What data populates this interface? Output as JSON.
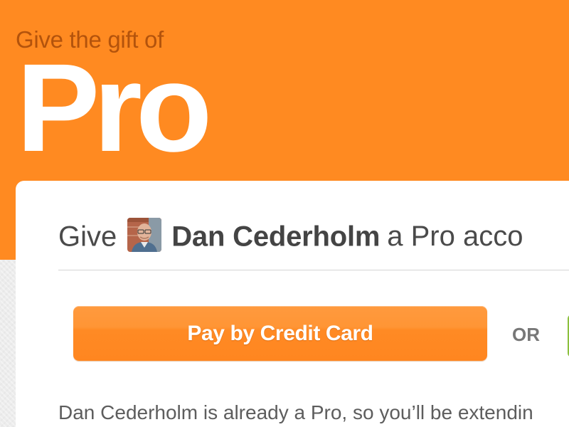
{
  "hero": {
    "kicker": "Give the gift of",
    "title": "Pro",
    "background_color": "#ff8a21"
  },
  "give_row": {
    "prefix": "Give",
    "avatar_icon": "user-avatar-photo",
    "user_name": "Dan Cederholm",
    "suffix": "a Pro acco"
  },
  "payment": {
    "credit_card_label": "Pay by Credit Card",
    "or_label": "OR",
    "button_color": "#ff8a24",
    "alt_button_color": "#8bbf3c"
  },
  "info_text": "Dan Cederholm is already a Pro, so you’ll be extendin"
}
